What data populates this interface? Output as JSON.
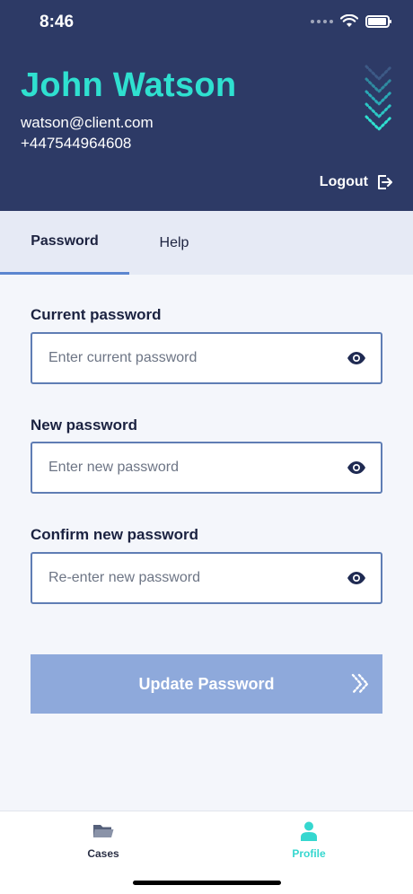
{
  "status": {
    "time": "8:46"
  },
  "profile": {
    "name": "John Watson",
    "email": "watson@client.com",
    "phone": "+447544964608"
  },
  "header": {
    "logout_label": "Logout"
  },
  "tabs": [
    {
      "label": "Password",
      "active": true
    },
    {
      "label": "Help",
      "active": false
    }
  ],
  "form": {
    "current": {
      "label": "Current password",
      "placeholder": "Enter current password",
      "value": ""
    },
    "new": {
      "label": "New password",
      "placeholder": "Enter new password",
      "value": ""
    },
    "confirm": {
      "label": "Confirm new password",
      "placeholder": "Re-enter new password",
      "value": ""
    },
    "submit_label": "Update Password"
  },
  "bottom_nav": [
    {
      "label": "Cases",
      "icon": "folder-icon",
      "active": false
    },
    {
      "label": "Profile",
      "icon": "person-icon",
      "active": true
    }
  ],
  "colors": {
    "header_bg": "#2d3a66",
    "accent_teal": "#2fe0d0",
    "button_bg": "#8ea9db",
    "tab_bg": "#e6eaf5",
    "field_border": "#5f7db4"
  }
}
